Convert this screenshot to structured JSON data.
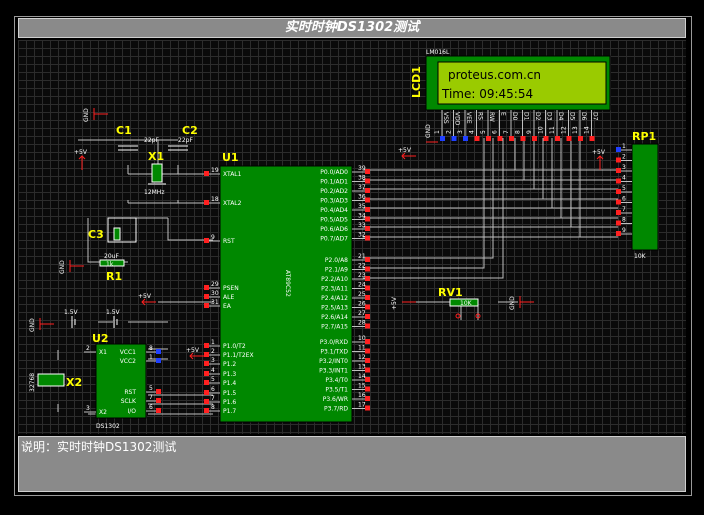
{
  "title": "实时时钟DS1302测试",
  "description": "说明：实时时钟DS1302测试",
  "colors": {
    "chip_fill": "#008800",
    "chip_border": "#000000",
    "ref_text": "#ffff00",
    "wire": "#c0c0c0",
    "pin_red": "#ff2020",
    "pin_blue": "#2040ff",
    "lcd_screen": "#9acb00"
  },
  "lcd": {
    "ref": "LCD1",
    "model": "LM016L",
    "line1": "proteus.com.cn",
    "line2": "Time: 09:45:54",
    "pins": [
      "VSS",
      "VDD",
      "VEE",
      "RS",
      "RW",
      "E",
      "D0",
      "D1",
      "D2",
      "D3",
      "D4",
      "D5",
      "D6",
      "D7"
    ],
    "pin_numbers": [
      "1",
      "2",
      "3",
      "4",
      "5",
      "6",
      "7",
      "8",
      "9",
      "10",
      "11",
      "12",
      "13",
      "14"
    ]
  },
  "mcu": {
    "ref": "U1",
    "part": "AT89C52",
    "left_pins": [
      {
        "num": "19",
        "name": "XTAL1"
      },
      {
        "num": "18",
        "name": "XTAL2"
      },
      {
        "num": "9",
        "name": "RST"
      },
      {
        "num": "29",
        "name": "PSEN"
      },
      {
        "num": "30",
        "name": "ALE"
      },
      {
        "num": "31",
        "name": "EA"
      },
      {
        "num": "1",
        "name": "P1.0/T2"
      },
      {
        "num": "2",
        "name": "P1.1/T2EX"
      },
      {
        "num": "3",
        "name": "P1.2"
      },
      {
        "num": "4",
        "name": "P1.3"
      },
      {
        "num": "5",
        "name": "P1.4"
      },
      {
        "num": "6",
        "name": "P1.5"
      },
      {
        "num": "7",
        "name": "P1.6"
      },
      {
        "num": "8",
        "name": "P1.7"
      }
    ],
    "right_pins_p0": [
      {
        "num": "39",
        "name": "P0.0/AD0"
      },
      {
        "num": "38",
        "name": "P0.1/AD1"
      },
      {
        "num": "37",
        "name": "P0.2/AD2"
      },
      {
        "num": "36",
        "name": "P0.3/AD3"
      },
      {
        "num": "35",
        "name": "P0.4/AD4"
      },
      {
        "num": "34",
        "name": "P0.5/AD5"
      },
      {
        "num": "33",
        "name": "P0.6/AD6"
      },
      {
        "num": "32",
        "name": "P0.7/AD7"
      }
    ],
    "right_pins_p2": [
      {
        "num": "21",
        "name": "P2.0/A8"
      },
      {
        "num": "22",
        "name": "P2.1/A9"
      },
      {
        "num": "23",
        "name": "P2.2/A10"
      },
      {
        "num": "24",
        "name": "P2.3/A11"
      },
      {
        "num": "25",
        "name": "P2.4/A12"
      },
      {
        "num": "26",
        "name": "P2.5/A13"
      },
      {
        "num": "27",
        "name": "P2.6/A14"
      },
      {
        "num": "28",
        "name": "P2.7/A15"
      }
    ],
    "right_pins_p3": [
      {
        "num": "10",
        "name": "P3.0/RXD"
      },
      {
        "num": "11",
        "name": "P3.1/TXD"
      },
      {
        "num": "12",
        "name": "P3.2/INT0"
      },
      {
        "num": "13",
        "name": "P3.3/INT1"
      },
      {
        "num": "14",
        "name": "P3.4/T0"
      },
      {
        "num": "15",
        "name": "P3.5/T1"
      },
      {
        "num": "16",
        "name": "P3.6/WR"
      },
      {
        "num": "17",
        "name": "P3.7/RD"
      }
    ]
  },
  "rtc": {
    "ref": "U2",
    "part": "DS1302",
    "left_pins": [
      {
        "num": "2",
        "name": "X1"
      },
      {
        "num": "3",
        "name": "X2"
      }
    ],
    "right_pins": [
      {
        "num": "8",
        "name": "VCC1"
      },
      {
        "num": "1",
        "name": "VCC2"
      },
      {
        "num": "5",
        "name": "RST"
      },
      {
        "num": "7",
        "name": "SCLK"
      },
      {
        "num": "6",
        "name": "I/O"
      }
    ]
  },
  "components": {
    "c1": {
      "ref": "C1",
      "value": "22pF"
    },
    "c2": {
      "ref": "C2",
      "value": "22pF"
    },
    "c3": {
      "ref": "C3",
      "value": "20uF"
    },
    "x1": {
      "ref": "X1",
      "value": "12MHz"
    },
    "x2": {
      "ref": "X2",
      "value": "32768"
    },
    "r1": {
      "ref": "R1",
      "value": "1k"
    },
    "rp1": {
      "ref": "RP1",
      "value": "10K",
      "pins": [
        "1",
        "2",
        "3",
        "4",
        "5",
        "6",
        "7",
        "8",
        "9"
      ]
    },
    "rv1": {
      "ref": "RV1",
      "value": "10K"
    },
    "bat1": {
      "value": "1.5V"
    },
    "bat2": {
      "value": "1.5V"
    }
  },
  "labels": {
    "gnd": "GND",
    "vcc": "+5V"
  }
}
